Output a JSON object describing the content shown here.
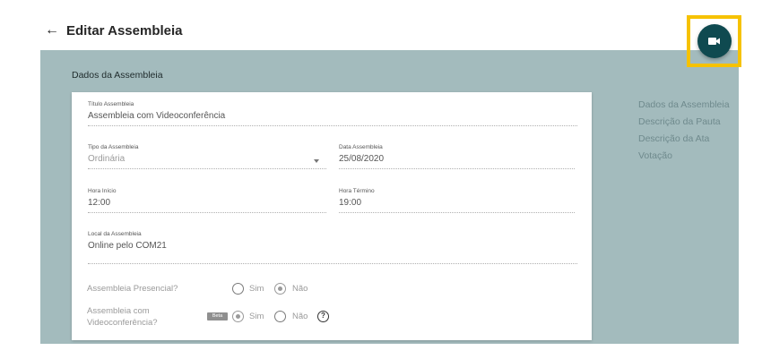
{
  "header": {
    "back_icon": "←",
    "title": "Editar Assembleia",
    "video_button_icon": "videocam-icon"
  },
  "section": {
    "title": "Dados da Assembleia"
  },
  "form": {
    "titulo": {
      "label": "Título Assembleia",
      "value": "Assembleia com Videoconferência"
    },
    "tipo": {
      "label": "Tipo da Assembleia",
      "value": "Ordinária"
    },
    "data": {
      "label": "Data Assembleia",
      "value": "25/08/2020"
    },
    "hora_inicio": {
      "label": "Hora Início",
      "value": "12:00"
    },
    "hora_termino": {
      "label": "Hora Término",
      "value": "19:00"
    },
    "local": {
      "label": "Local da Assembleia",
      "value": "Online pelo COM21"
    },
    "presencial": {
      "question": "Assembleia Presencial?",
      "sim": "Sim",
      "nao": "Não",
      "selected": "Não"
    },
    "videoconferencia": {
      "question_line1": "Assembleia com",
      "question_line2": "Videoconferência?",
      "badge": "Beta",
      "sim": "Sim",
      "nao": "Não",
      "selected": "Sim",
      "help": "?"
    }
  },
  "side_nav": {
    "items": [
      "Dados da Assembleia",
      "Descrição da Pauta",
      "Descrição da Ata",
      "Votação"
    ]
  },
  "colors": {
    "panel": "#a3bbbd",
    "accent_button": "#0f4a50",
    "highlight": "#f6c200"
  }
}
